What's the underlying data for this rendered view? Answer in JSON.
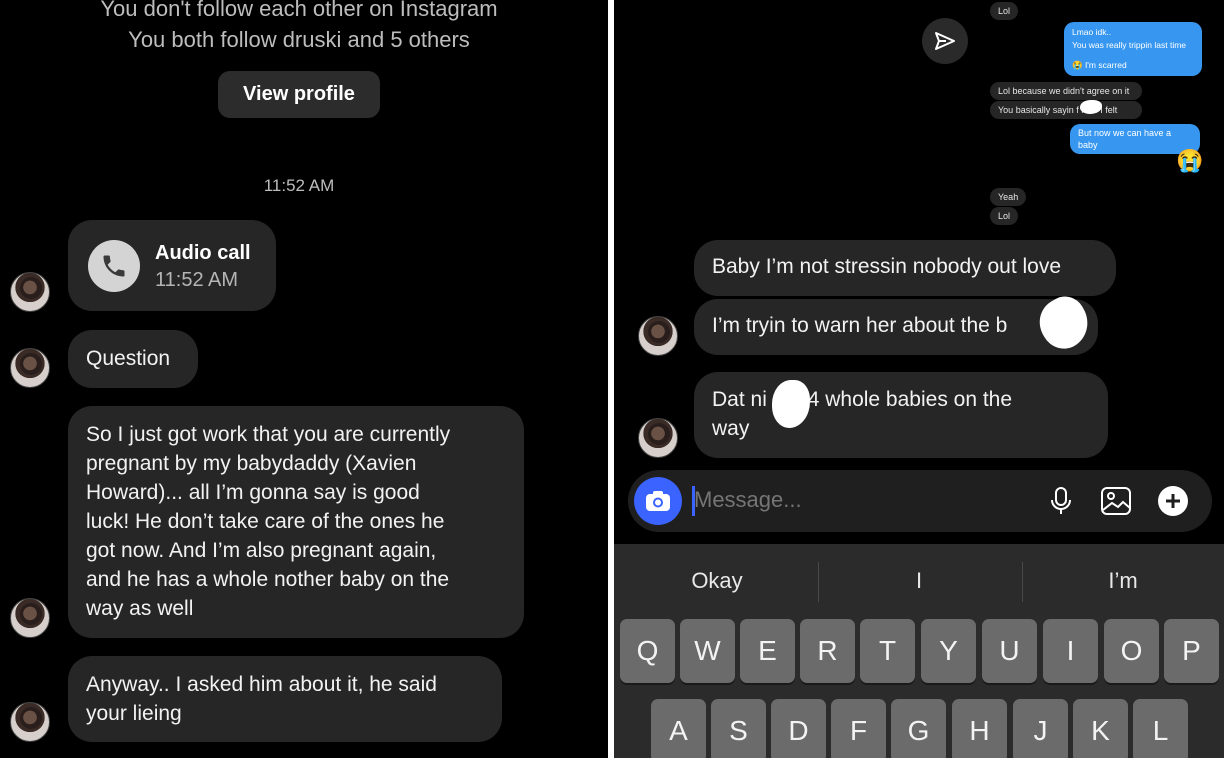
{
  "left": {
    "header_line1": "You don't follow each other on Instagram",
    "header_line2": "You both follow druski and 5 others",
    "view_profile": "View profile",
    "timestamp": "11:52 AM",
    "call": {
      "title": "Audio call",
      "time": "11:52 AM",
      "icon": "phone-icon"
    },
    "messages": [
      "Question",
      "So I just got work that you are currently\npregnant by my babydaddy (Xavien\nHoward)... all I’m gonna say is good\nluck! He don’t take care of the ones he\ngot now. And I’m also pregnant again,\nand he has a whole nother baby on the\nway as well",
      "Anyway.. I asked him about it, he said\nyour lieing"
    ]
  },
  "right": {
    "mini": {
      "lol_top": "Lol",
      "blue1_line1": "Lmao idk..",
      "blue1_line2": "You was really trippin last time",
      "blue1_line3": "😭 I'm scarred",
      "gray1": "Lol because we didn't agree on it",
      "gray2": "You basically sayin f    how I felt",
      "blue2": "But now we can have a baby",
      "emoji": "😭",
      "yeah": "Yeah",
      "lol_bottom": "Lol"
    },
    "messages": [
      "Baby I’m not stressin nobody out love",
      "I’m tryin to warn her about the b",
      "Dat ni        got 4 whole babies on the\nway"
    ],
    "input": {
      "placeholder": "Message..."
    },
    "icons": {
      "send": "send-icon",
      "camera": "camera-icon",
      "mic": "mic-icon",
      "gallery": "gallery-icon",
      "plus": "plus-icon"
    },
    "suggestions": [
      "Okay",
      "I",
      "I’m"
    ],
    "keys_row1": [
      "Q",
      "W",
      "E",
      "R",
      "T",
      "Y",
      "U",
      "I",
      "O",
      "P"
    ],
    "keys_row2": [
      "A",
      "S",
      "D",
      "F",
      "G",
      "H",
      "J",
      "K",
      "L"
    ]
  },
  "colors": {
    "bubble": "#262626",
    "blue": "#3797f0",
    "camera": "#3a63ff",
    "background": "#000000"
  }
}
